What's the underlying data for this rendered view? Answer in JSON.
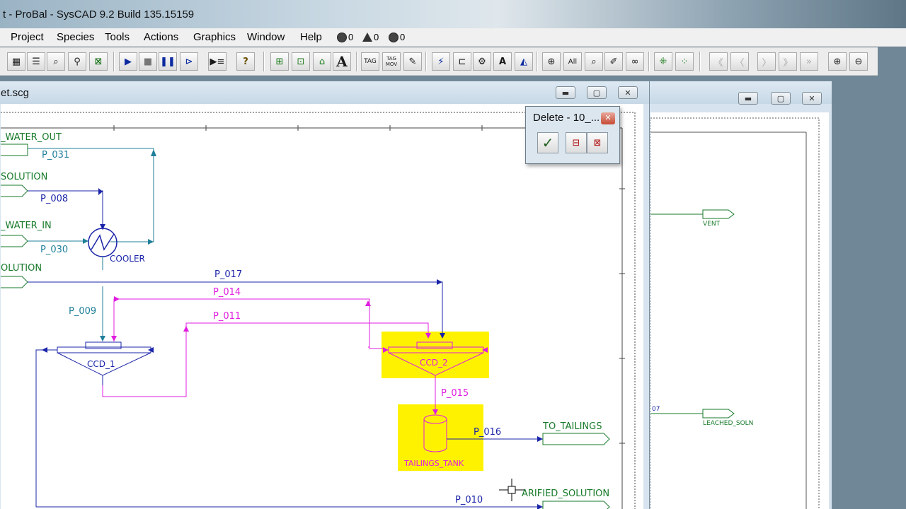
{
  "window_title": "t - ProBal  - SysCAD 9.2 Build 135.15159",
  "menu": [
    "Project",
    "Species",
    "Tools",
    "Actions",
    "Graphics",
    "Window",
    "Help"
  ],
  "status_counts": {
    "errors": "0",
    "warnings": "0",
    "messages": "0"
  },
  "toolbar": {
    "run_icon": "play-icon",
    "stop_icon": "stop-icon",
    "pause_icon": "pause-icon",
    "help_glyph": "?",
    "text_glyph": "A",
    "tag_label": "TAG",
    "tag_move_label": "TAG MOV",
    "all_label": "All",
    "nav": [
      "《",
      "〈",
      "〉",
      "》"
    ]
  },
  "flowsheet_window": {
    "title": "et.scg",
    "labels": {
      "water_out": "_WATER_OUT",
      "p031": "P_031",
      "solution1": "SOLUTION",
      "p008": "P_008",
      "water_in": "_WATER_IN",
      "p030": "P_030",
      "cooler": "COOLER",
      "solution2": "OLUTION",
      "p017": "P_017",
      "p014": "P_014",
      "p009": "P_009",
      "p011": "P_011",
      "ccd1": "CCD_1",
      "ccd2": "CCD_2",
      "p015": "P_015",
      "p016": "P_016",
      "to_tailings": "TO_TAILINGS",
      "tailings_tank": "TAILINGS_TANK",
      "p010": "P_010",
      "clarified": "ARIFIED_SOLUTION"
    }
  },
  "second_window": {
    "labels": {
      "vent": "VENT",
      "leached": "LEACHED_SOLN",
      "p07": "07"
    }
  },
  "delete_dialog": {
    "title": "Delete - 10_...",
    "ok_glyph": "✓"
  },
  "colors": {
    "blue": "#1a24a8",
    "teal": "#1f7f9a",
    "magenta": "#e01ce0",
    "green": "#177a2a",
    "highlight": "#fff200"
  }
}
